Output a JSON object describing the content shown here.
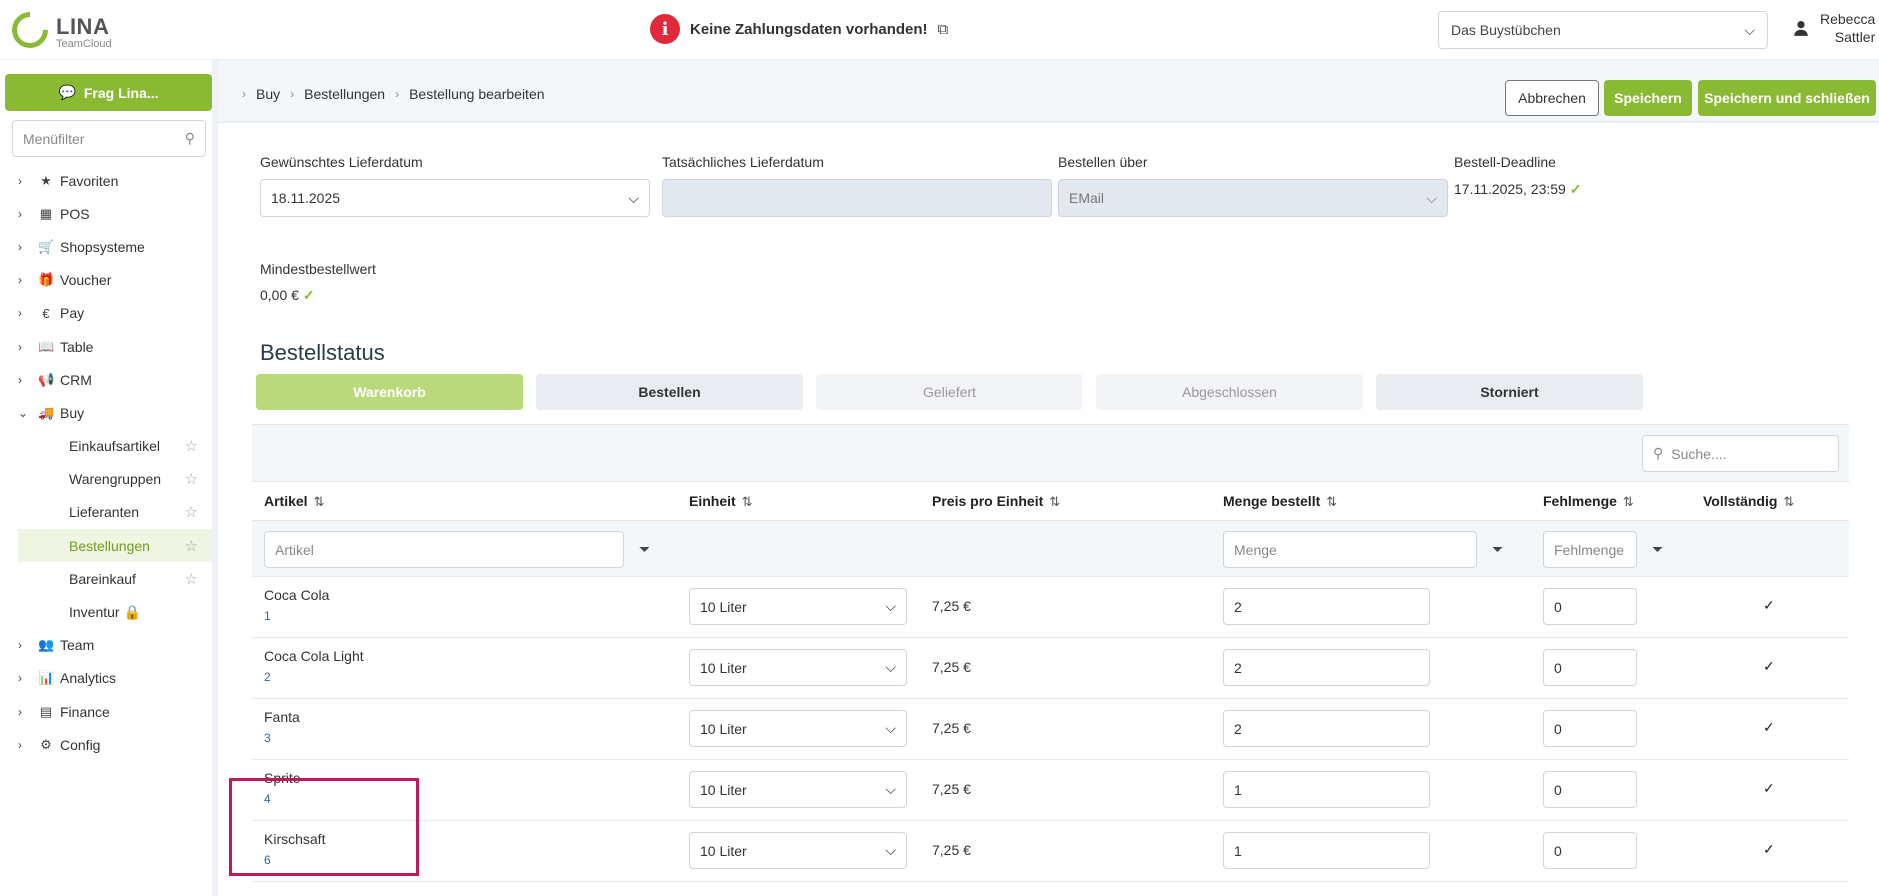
{
  "header": {
    "logo_name": "LINA",
    "logo_sub": "TeamCloud",
    "alert_text": "Keine Zahlungsdaten vorhanden!",
    "venue": "Das Buystübchen",
    "user_first": "Rebecca",
    "user_last": "Sattler"
  },
  "sidebar": {
    "ask_label": "Frag Lina...",
    "filter_placeholder": "Menüfilter",
    "items": [
      {
        "label": "Favoriten",
        "icon": "star-icon"
      },
      {
        "label": "POS",
        "icon": "register-icon"
      },
      {
        "label": "Shopsysteme",
        "icon": "cart-icon"
      },
      {
        "label": "Voucher",
        "icon": "gift-icon"
      },
      {
        "label": "Pay",
        "icon": "euro-icon"
      },
      {
        "label": "Table",
        "icon": "book-icon"
      },
      {
        "label": "CRM",
        "icon": "megaphone-icon"
      },
      {
        "label": "Buy",
        "icon": "truck-icon"
      }
    ],
    "buy_sub": [
      "Einkaufsartikel",
      "Warengruppen",
      "Lieferanten",
      "Bestellungen",
      "Bareinkauf",
      "Inventur"
    ],
    "items_after": [
      {
        "label": "Team",
        "icon": "users-icon"
      },
      {
        "label": "Analytics",
        "icon": "chart-icon"
      },
      {
        "label": "Finance",
        "icon": "calculator-icon"
      },
      {
        "label": "Config",
        "icon": "gears-icon"
      }
    ]
  },
  "toolbar": {
    "crumbs": [
      "Buy",
      "Bestellungen",
      "Bestellung bearbeiten"
    ],
    "cancel": "Abbrechen",
    "save": "Speichern",
    "save_close": "Speichern und schließen"
  },
  "form": {
    "desired_date_label": "Gewünschtes Lieferdatum",
    "desired_date": "18.11.2025",
    "actual_date_label": "Tatsächliches Lieferdatum",
    "order_via_label": "Bestellen über",
    "order_via": "EMail",
    "deadline_label": "Bestell-Deadline",
    "deadline": "17.11.2025, 23:59",
    "min_value_label": "Mindestbestellwert",
    "min_value": "0,00 €"
  },
  "status": {
    "title": "Bestellstatus",
    "tabs": [
      "Warenkorb",
      "Bestellen",
      "Geliefert",
      "Abgeschlossen",
      "Storniert"
    ]
  },
  "table": {
    "search_placeholder": "Suche....",
    "headers": [
      "Artikel",
      "Einheit",
      "Preis pro Einheit",
      "Menge bestellt",
      "Fehlmenge",
      "Vollständig"
    ],
    "filters": {
      "artikel": "Artikel",
      "menge": "Menge",
      "fehlmenge": "Fehlmenge"
    },
    "rows": [
      {
        "name": "Coca Cola",
        "num": "1",
        "unit": "10 Liter",
        "price": "7,25 €",
        "qty": "2",
        "missing": "0"
      },
      {
        "name": "Coca Cola Light",
        "num": "2",
        "unit": "10 Liter",
        "price": "7,25 €",
        "qty": "2",
        "missing": "0"
      },
      {
        "name": "Fanta",
        "num": "3",
        "unit": "10 Liter",
        "price": "7,25 €",
        "qty": "2",
        "missing": "0"
      },
      {
        "name": "Sprite",
        "num": "4",
        "unit": "10 Liter",
        "price": "7,25 €",
        "qty": "1",
        "missing": "0"
      },
      {
        "name": "Kirschsaft",
        "num": "6",
        "unit": "10 Liter",
        "price": "7,25 €",
        "qty": "1",
        "missing": "0"
      }
    ]
  },
  "colors": {
    "accent": "#8ab933",
    "alert": "#e02a3b",
    "highlight": "#c2185b"
  }
}
